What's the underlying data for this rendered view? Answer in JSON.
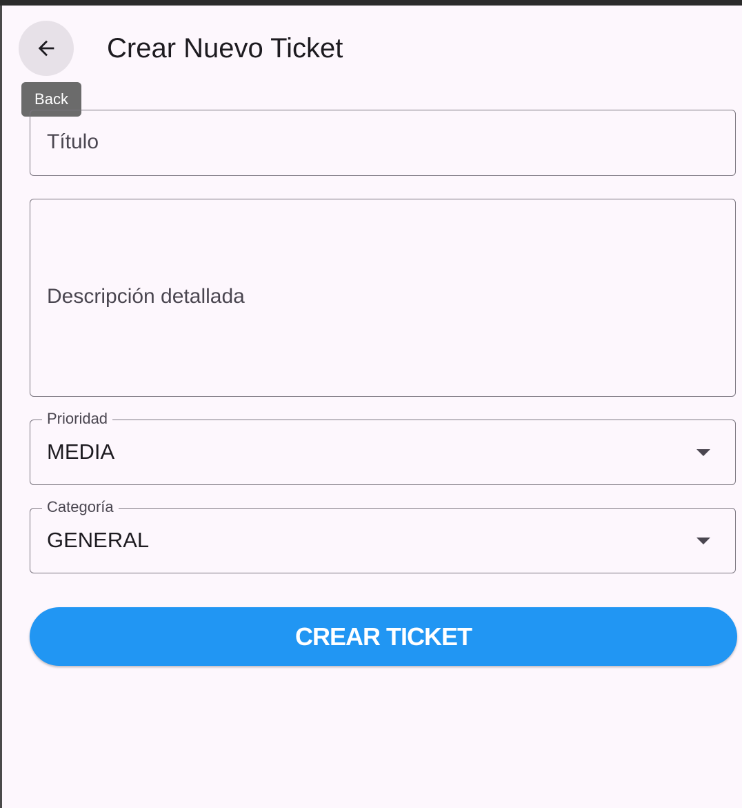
{
  "header": {
    "title": "Crear Nuevo Ticket",
    "back_icon": "arrow-left-icon",
    "back_tooltip": "Back"
  },
  "form": {
    "titulo_placeholder": "Título",
    "descripcion_placeholder": "Descripción detallada",
    "prioridad": {
      "label": "Prioridad",
      "value": "MEDIA"
    },
    "categoria": {
      "label": "Categoría",
      "value": "GENERAL"
    },
    "submit_label": "CREAR TICKET"
  },
  "colors": {
    "background": "#fdf7fd",
    "primary": "#2196f3",
    "outline": "#7a757f",
    "tooltip": "#6b6b6b"
  }
}
